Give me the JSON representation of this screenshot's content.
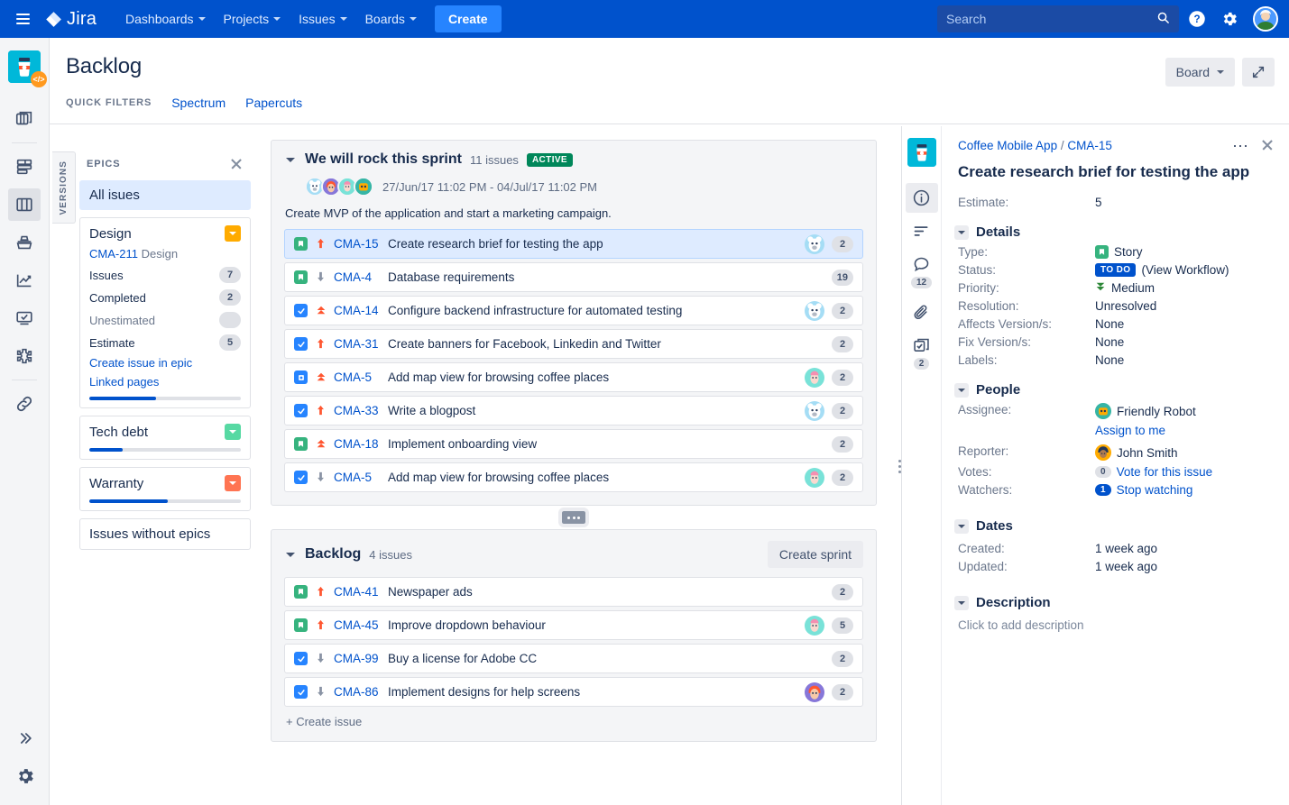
{
  "topnav": {
    "brand": "Jira",
    "items": [
      {
        "label": "Dashboards",
        "has_caret": true
      },
      {
        "label": "Projects",
        "has_caret": true
      },
      {
        "label": "Issues",
        "has_caret": true
      },
      {
        "label": "Boards",
        "has_caret": true
      }
    ],
    "create_label": "Create",
    "search": {
      "placeholder": "Search",
      "value": ""
    },
    "icons": [
      "search-icon",
      "help-icon",
      "settings-icon",
      "profile-avatar"
    ]
  },
  "rail": {
    "project_badge": "</>",
    "items": [
      {
        "name": "backlog-stack-icon"
      },
      {
        "name": "roadmap-icon"
      },
      {
        "name": "board-columns-icon",
        "selected": true
      },
      {
        "name": "releases-icon"
      },
      {
        "name": "reports-icon"
      },
      {
        "name": "issues-screen-icon"
      },
      {
        "name": "add-ons-icon"
      },
      {
        "name": "links-icon"
      }
    ],
    "bottom": [
      {
        "name": "expand-sidebar-icon"
      },
      {
        "name": "project-settings-gear-icon"
      }
    ]
  },
  "header": {
    "title": "Backlog",
    "quick_filters_label": "QUICK FILTERS",
    "filters": [
      "Spectrum",
      "Papercuts"
    ],
    "board_button": "Board",
    "fullscreen_icon": "expand-icon"
  },
  "versions_tab": "VERSIONS",
  "epics": {
    "panel_title": "EPICS",
    "close_icon": "close-icon",
    "all_issues": "All isues",
    "cards": [
      {
        "name": "Design",
        "color": "#FFAB00",
        "key": "CMA-211",
        "key_suffix": "Design",
        "stats": [
          {
            "label": "Issues",
            "value": "7"
          },
          {
            "label": "Completed",
            "value": "2"
          },
          {
            "label": "Unestimated",
            "value": ""
          },
          {
            "label": "Estimate",
            "value": "5"
          }
        ],
        "links": [
          "Create issue in epic",
          "Linked pages"
        ],
        "progress": 44
      },
      {
        "name": "Tech debt",
        "color": "#57D9A3",
        "progress": 22
      },
      {
        "name": "Warranty",
        "color": "#FF7452",
        "progress": 52
      }
    ],
    "without_epics": "Issues without epics"
  },
  "sprint": {
    "title": "We will rock this sprint",
    "count": "11 issues",
    "status": "ACTIVE",
    "dates": "27/Jun/17 11:02 PM - 04/Jul/17 11:02 PM",
    "goal": "Create MVP of the application and start a marketing campaign.",
    "member_avatars": [
      "#A5DDF5",
      "#8777D9",
      "#79E2D8",
      "#36B5A5"
    ],
    "issues": [
      {
        "type": "story",
        "priority": "high",
        "key": "CMA-15",
        "summary": "Create research brief for testing the app",
        "estimate": "2",
        "avatar": "#A5DDF5",
        "selected": true
      },
      {
        "type": "story",
        "priority": "low",
        "key": "CMA-4",
        "summary": "Database requirements",
        "estimate": "19",
        "avatar": ""
      },
      {
        "type": "task",
        "priority": "highest",
        "key": "CMA-14",
        "summary": "Configure backend infrastructure for automated testing",
        "estimate": "2",
        "avatar": "#A5DDF5"
      },
      {
        "type": "task",
        "priority": "high",
        "key": "CMA-31",
        "summary": "Create banners for Facebook, Linkedin and Twitter",
        "estimate": "2",
        "avatar": ""
      },
      {
        "type": "bug-blue",
        "priority": "highest",
        "key": "CMA-5",
        "summary": "Add map view for browsing coffee places",
        "estimate": "2",
        "avatar": "#79E2D8"
      },
      {
        "type": "task",
        "priority": "high",
        "key": "CMA-33",
        "summary": "Write a blogpost",
        "estimate": "2",
        "avatar": "#A5DDF5"
      },
      {
        "type": "story",
        "priority": "highest",
        "key": "CMA-18",
        "summary": "Implement onboarding view",
        "estimate": "2",
        "avatar": ""
      },
      {
        "type": "task",
        "priority": "low",
        "key": "CMA-5",
        "summary": "Add map view for browsing coffee places",
        "estimate": "2",
        "avatar": "#79E2D8"
      }
    ]
  },
  "backlog": {
    "title": "Backlog",
    "count": "4 issues",
    "create_sprint": "Create sprint",
    "create_issue": "+ Create issue",
    "issues": [
      {
        "type": "story",
        "priority": "high",
        "key": "CMA-41",
        "summary": "Newspaper ads",
        "estimate": "2",
        "avatar": ""
      },
      {
        "type": "story",
        "priority": "high",
        "key": "CMA-45",
        "summary": "Improve dropdown behaviour",
        "estimate": "5",
        "avatar": "#79E2D8"
      },
      {
        "type": "task",
        "priority": "low",
        "key": "CMA-99",
        "summary": "Buy a license for Adobe CC",
        "estimate": "2",
        "avatar": ""
      },
      {
        "type": "task",
        "priority": "low",
        "key": "CMA-86",
        "summary": "Implement designs for help screens",
        "estimate": "2",
        "avatar": "#8777D9"
      }
    ]
  },
  "detail": {
    "breadcrumb_project": "Coffee Mobile App",
    "breadcrumb_sep": " / ",
    "breadcrumb_issue": "CMA-15",
    "more_icon": "more-actions-icon",
    "close_icon": "close-icon",
    "title": "Create research brief for testing the app",
    "estimate_label": "Estimate:",
    "estimate_value": "5",
    "rail": [
      {
        "name": "details-info-icon",
        "count": "",
        "selected": true
      },
      {
        "name": "activity-icon",
        "count": ""
      },
      {
        "name": "comments-icon",
        "count": "12"
      },
      {
        "name": "attachments-icon",
        "count": ""
      },
      {
        "name": "subtasks-icon",
        "count": "2"
      }
    ],
    "details": {
      "heading": "Details",
      "rows": [
        {
          "label": "Type:",
          "value": "Story",
          "kind": "type"
        },
        {
          "label": "Status:",
          "value": "TO DO",
          "extra": "(View Workflow)",
          "kind": "status"
        },
        {
          "label": "Priority:",
          "value": "Medium",
          "kind": "priority"
        },
        {
          "label": "Resolution:",
          "value": "Unresolved",
          "kind": "text"
        },
        {
          "label": "Affects Version/s:",
          "value": "None",
          "kind": "text"
        },
        {
          "label": "Fix Version/s:",
          "value": "None",
          "kind": "text"
        },
        {
          "label": "Labels:",
          "value": "None",
          "kind": "text"
        }
      ]
    },
    "people": {
      "heading": "People",
      "assignee_label": "Assignee:",
      "assignee_name": "Friendly Robot",
      "assignee_color": "#36B5A5",
      "assign_to_me": "Assign to me",
      "reporter_label": "Reporter:",
      "reporter_name": "John Smith",
      "reporter_color": "#FFAB00",
      "votes_label": "Votes:",
      "votes_count": "0",
      "votes_link": "Vote for this issue",
      "watchers_label": "Watchers:",
      "watchers_count": "1",
      "watchers_link": "Stop watching"
    },
    "dates": {
      "heading": "Dates",
      "rows": [
        {
          "label": "Created:",
          "value": "1 week ago"
        },
        {
          "label": "Updated:",
          "value": "1 week ago"
        }
      ]
    },
    "description": {
      "heading": "Description",
      "placeholder": "Click to add description"
    }
  },
  "colors": {
    "brand_blue": "#0052CC",
    "create_blue": "#2684FF",
    "active_green": "#00875A",
    "story_green": "#36B37E",
    "task_blue": "#2684FF",
    "priority_high": "#FF5630",
    "priority_low": "#8993A4"
  }
}
